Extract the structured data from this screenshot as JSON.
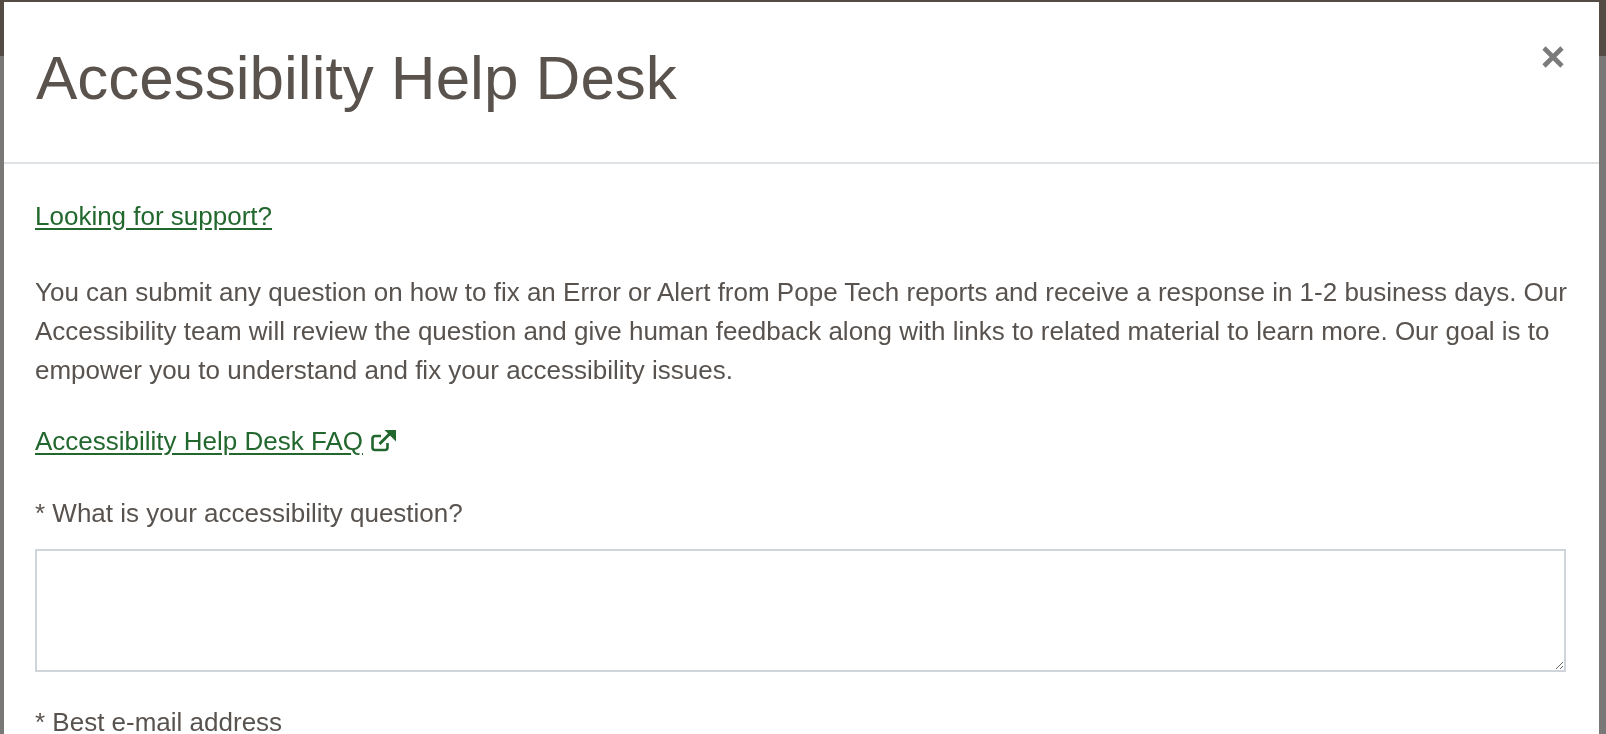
{
  "dialog": {
    "title": "Accessibility Help Desk"
  },
  "support_link": {
    "label": "Looking for support?"
  },
  "description": "You can submit any question on how to fix an Error or Alert from Pope Tech reports and receive a response in 1-2 business days. Our Accessibility team will review the question and give human feedback along with links to related material to learn more. Our goal is to empower you to understand and fix your accessibility issues.",
  "faq_link": {
    "label": "Accessibility Help Desk FAQ",
    "external": true
  },
  "form": {
    "fields": [
      {
        "label": "* What is your accessibility question?",
        "kind": "textarea"
      },
      {
        "label": "* Best e-mail address",
        "kind": "email"
      }
    ]
  }
}
